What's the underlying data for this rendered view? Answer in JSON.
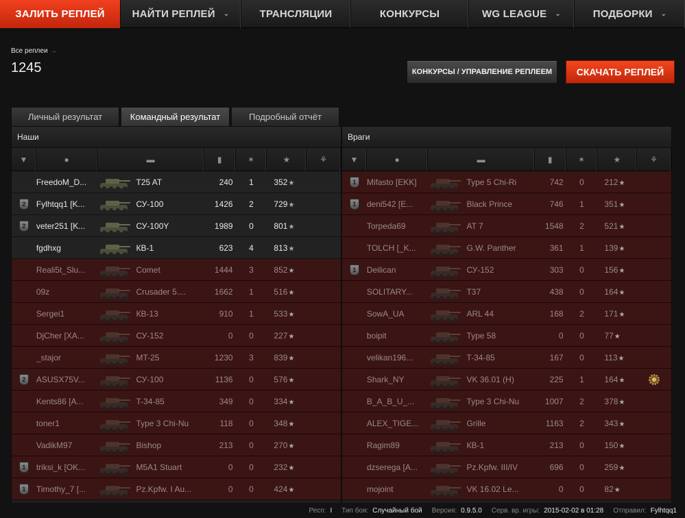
{
  "nav": {
    "items": [
      {
        "label": "ЗАЛИТЬ РЕПЛЕЙ",
        "active": true,
        "dropdown": false
      },
      {
        "label": "НАЙТИ РЕПЛЕЙ",
        "active": false,
        "dropdown": true
      },
      {
        "label": "ТРАНСЛЯЦИИ",
        "active": false,
        "dropdown": false
      },
      {
        "label": "КОНКУРСЫ",
        "active": false,
        "dropdown": false
      },
      {
        "label": "WG LEAGUE",
        "active": false,
        "dropdown": true
      },
      {
        "label": "ПОДБОРКИ",
        "active": false,
        "dropdown": true
      }
    ]
  },
  "header": {
    "breadcrumb": "Все реплеи",
    "replay_id": "1245",
    "manage_button": "КОНКУРСЫ / УПРАВЛЕНИЕ РЕПЛЕЕМ",
    "download_button": "СКАЧАТЬ РЕПЛЕЙ"
  },
  "tabs": [
    "Личный результат",
    "Командный результат",
    "Подробный отчёт"
  ],
  "teams": {
    "allies": {
      "title": "Наши",
      "rows": [
        {
          "badge": "",
          "name": "FreedoM_D...",
          "tank": "T25 AT",
          "damage": "240",
          "kills": "1",
          "xp": "352",
          "alive": true,
          "medal": false
        },
        {
          "badge": "2",
          "name": "Fylhtqq1 [K...",
          "tank": "СУ-100",
          "damage": "1426",
          "kills": "2",
          "xp": "729",
          "alive": true,
          "medal": false
        },
        {
          "badge": "2",
          "name": "veter251 [K...",
          "tank": "СУ-100Y",
          "damage": "1989",
          "kills": "0",
          "xp": "801",
          "alive": true,
          "medal": false
        },
        {
          "badge": "",
          "name": "fgdhxg",
          "tank": "КВ-1",
          "damage": "623",
          "kills": "4",
          "xp": "813",
          "alive": true,
          "medal": false
        },
        {
          "badge": "",
          "name": "Reali5t_Slu...",
          "tank": "Comet",
          "damage": "1444",
          "kills": "3",
          "xp": "852",
          "alive": false,
          "medal": false
        },
        {
          "badge": "",
          "name": "09z",
          "tank": "Crusader 5....",
          "damage": "1662",
          "kills": "1",
          "xp": "516",
          "alive": false,
          "medal": false
        },
        {
          "badge": "",
          "name": "Sergei1",
          "tank": "КВ-13",
          "damage": "910",
          "kills": "1",
          "xp": "533",
          "alive": false,
          "medal": false
        },
        {
          "badge": "",
          "name": "DjCher [XA...",
          "tank": "СУ-152",
          "damage": "0",
          "kills": "0",
          "xp": "227",
          "alive": false,
          "medal": false
        },
        {
          "badge": "",
          "name": "_stajor",
          "tank": "MT-25",
          "damage": "1230",
          "kills": "3",
          "xp": "839",
          "alive": false,
          "medal": false
        },
        {
          "badge": "2",
          "name": "ASUSX75V...",
          "tank": "СУ-100",
          "damage": "1136",
          "kills": "0",
          "xp": "576",
          "alive": false,
          "medal": false
        },
        {
          "badge": "",
          "name": "Kents86 [A...",
          "tank": "T-34-85",
          "damage": "349",
          "kills": "0",
          "xp": "334",
          "alive": false,
          "medal": false
        },
        {
          "badge": "",
          "name": "toner1",
          "tank": "Type 3 Chi-Nu",
          "damage": "118",
          "kills": "0",
          "xp": "348",
          "alive": false,
          "medal": false
        },
        {
          "badge": "",
          "name": "VadikM97",
          "tank": "Bishop",
          "damage": "213",
          "kills": "0",
          "xp": "270",
          "alive": false,
          "medal": false
        },
        {
          "badge": "1",
          "name": "triksi_k [OK...",
          "tank": "M5A1 Stuart",
          "damage": "0",
          "kills": "0",
          "xp": "232",
          "alive": false,
          "medal": false
        },
        {
          "badge": "1",
          "name": "Timothy_7 [...",
          "tank": "Pz.Kpfw. I Au...",
          "damage": "0",
          "kills": "0",
          "xp": "424",
          "alive": false,
          "medal": false
        }
      ]
    },
    "enemies": {
      "title": "Враги",
      "rows": [
        {
          "badge": "1",
          "name": "Mifasto [EKK]",
          "tank": "Type 5 Chi-Ri",
          "damage": "742",
          "kills": "0",
          "xp": "212",
          "alive": false,
          "medal": false
        },
        {
          "badge": "1",
          "name": "deni542 [E...",
          "tank": "Black Prince",
          "damage": "746",
          "kills": "1",
          "xp": "351",
          "alive": false,
          "medal": false
        },
        {
          "badge": "",
          "name": "Torpeda69",
          "tank": "AT 7",
          "damage": "1548",
          "kills": "2",
          "xp": "521",
          "alive": false,
          "medal": false
        },
        {
          "badge": "",
          "name": "TOLCH [_K...",
          "tank": "G.W. Panther",
          "damage": "361",
          "kills": "1",
          "xp": "139",
          "alive": false,
          "medal": false
        },
        {
          "badge": "1",
          "name": "Deilican",
          "tank": "СУ-152",
          "damage": "303",
          "kills": "0",
          "xp": "156",
          "alive": false,
          "medal": false
        },
        {
          "badge": "",
          "name": "SOLITARY...",
          "tank": "T37",
          "damage": "438",
          "kills": "0",
          "xp": "164",
          "alive": false,
          "medal": false
        },
        {
          "badge": "",
          "name": "SowA_UA",
          "tank": "ARL 44",
          "damage": "168",
          "kills": "2",
          "xp": "171",
          "alive": false,
          "medal": false
        },
        {
          "badge": "",
          "name": "boipit",
          "tank": "Type 58",
          "damage": "0",
          "kills": "0",
          "xp": "77",
          "alive": false,
          "medal": false
        },
        {
          "badge": "",
          "name": "velikan196...",
          "tank": "T-34-85",
          "damage": "167",
          "kills": "0",
          "xp": "113",
          "alive": false,
          "medal": false
        },
        {
          "badge": "",
          "name": "Shark_NY",
          "tank": "VK 36.01 (H)",
          "damage": "225",
          "kills": "1",
          "xp": "164",
          "alive": false,
          "medal": true
        },
        {
          "badge": "",
          "name": "B_A_B_U_...",
          "tank": "Type 3 Chi-Nu",
          "damage": "1007",
          "kills": "2",
          "xp": "378",
          "alive": false,
          "medal": false
        },
        {
          "badge": "",
          "name": "ALEX_TIGE...",
          "tank": "Grille",
          "damage": "1163",
          "kills": "2",
          "xp": "343",
          "alive": false,
          "medal": false
        },
        {
          "badge": "",
          "name": "Ragim89",
          "tank": "КВ-1",
          "damage": "213",
          "kills": "0",
          "xp": "150",
          "alive": false,
          "medal": false
        },
        {
          "badge": "",
          "name": "dzserega [A...",
          "tank": "Pz.Kpfw. III/IV",
          "damage": "696",
          "kills": "0",
          "xp": "259",
          "alive": false,
          "medal": false
        },
        {
          "badge": "",
          "name": "mojoint",
          "tank": "VK 16.02 Le...",
          "damage": "0",
          "kills": "0",
          "xp": "82",
          "alive": false,
          "medal": false
        }
      ]
    }
  },
  "footer": {
    "items": [
      {
        "label": "Респ:",
        "value": "I"
      },
      {
        "label": "Тип боя:",
        "value": "Случайный бой"
      },
      {
        "label": "Версия:",
        "value": "0.9.5.0"
      },
      {
        "label": "Серв. вр. игры:",
        "value": "2015-02-02 в 01:28"
      },
      {
        "label": "Отправил:",
        "value": "Fylhtqq1"
      }
    ]
  },
  "colors": {
    "accent": "#e0361a",
    "dead_row": "#3b1414",
    "alive_row": "#222222"
  }
}
